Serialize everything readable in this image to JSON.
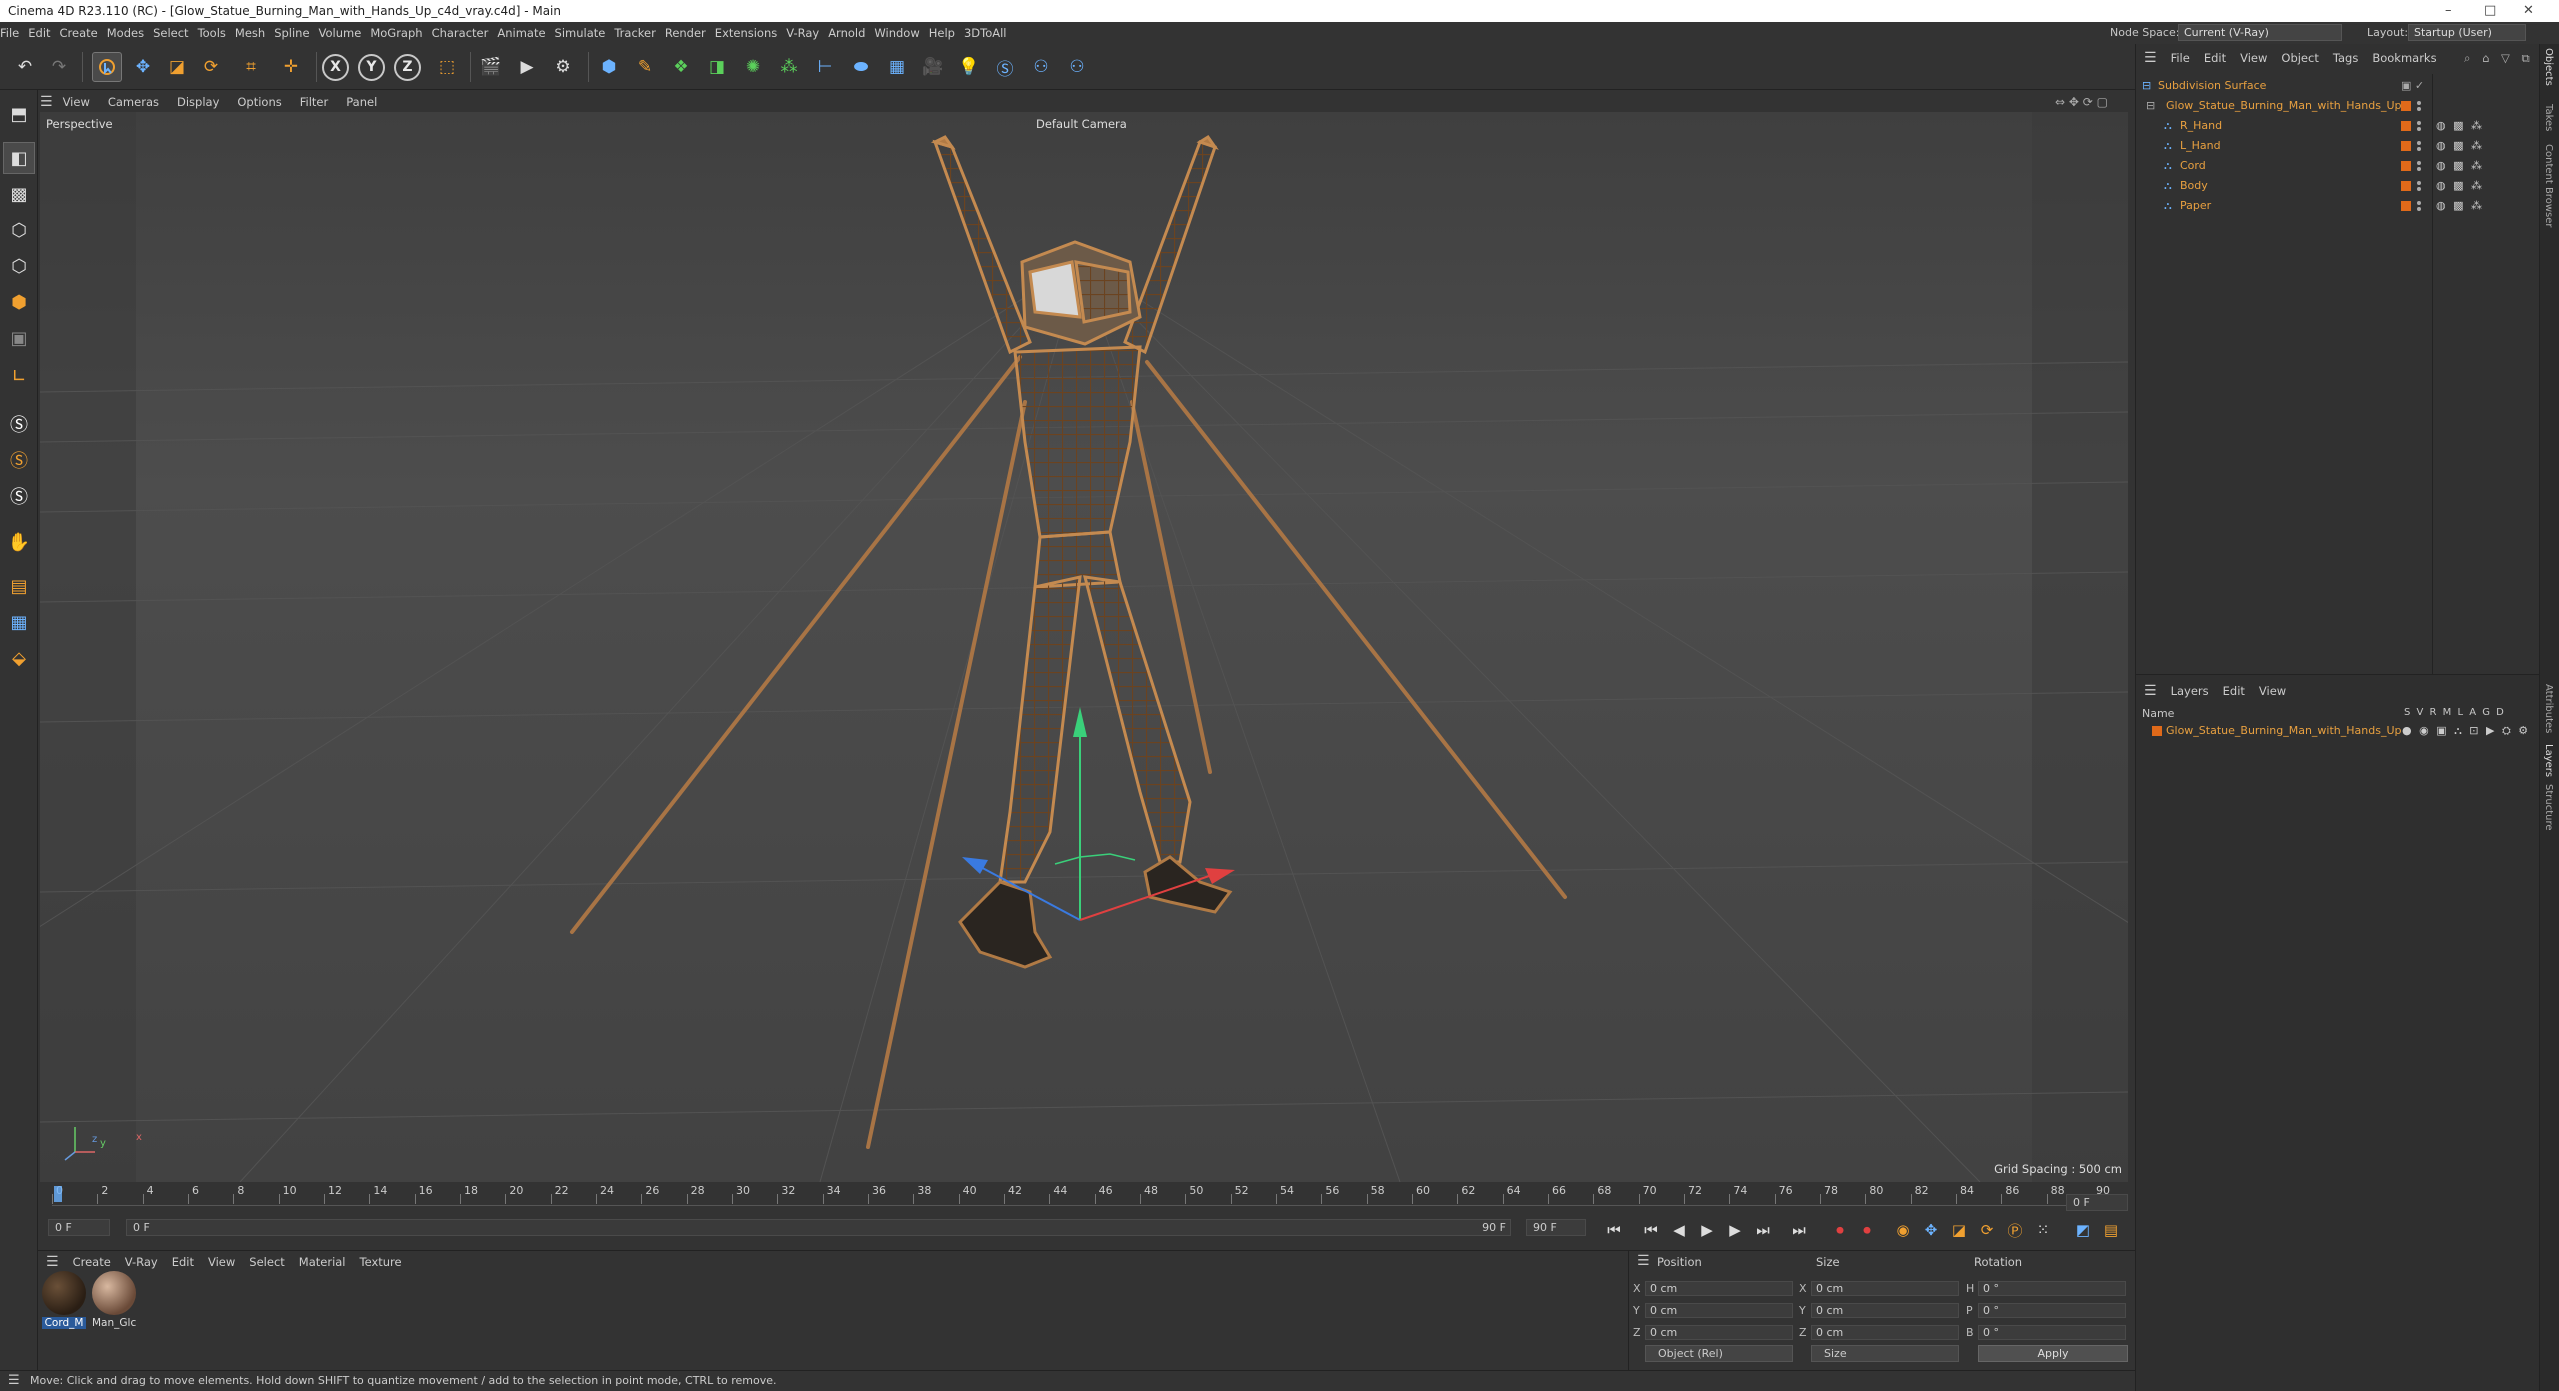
{
  "window": {
    "title": "Cinema 4D R23.110 (RC) - [Glow_Statue_Burning_Man_with_Hands_Up_c4d_vray.c4d] - Main",
    "controls": [
      "–",
      "□",
      "✕"
    ]
  },
  "menubar": {
    "items": [
      "File",
      "Edit",
      "Create",
      "Modes",
      "Select",
      "Tools",
      "Mesh",
      "Spline",
      "Volume",
      "MoGraph",
      "Character",
      "Animate",
      "Simulate",
      "Tracker",
      "Render",
      "Extensions",
      "V-Ray",
      "Arnold",
      "Window",
      "Help",
      "3DToAll"
    ],
    "node_space_label": "Node Space:",
    "node_space_value": "Current (V-Ray)",
    "layout_label": "Layout:",
    "layout_value": "Startup (User)"
  },
  "toolbar": {
    "axis": [
      "X",
      "Y",
      "Z"
    ]
  },
  "viewport": {
    "menu": [
      "View",
      "Cameras",
      "Display",
      "Options",
      "Filter",
      "Panel"
    ],
    "mode": "Perspective",
    "camera": "Default Camera",
    "grid_spacing": "Grid Spacing : 500 cm",
    "axis_x": "x",
    "axis_y": "y",
    "axis_z": "z",
    "icons": "⇔ ✥ ⟳ ▢"
  },
  "timeline": {
    "ticks": [
      "0",
      "2",
      "4",
      "6",
      "8",
      "10",
      "12",
      "14",
      "16",
      "18",
      "20",
      "22",
      "24",
      "26",
      "28",
      "30",
      "32",
      "34",
      "36",
      "38",
      "40",
      "42",
      "44",
      "46",
      "48",
      "50",
      "52",
      "54",
      "56",
      "58",
      "60",
      "62",
      "64",
      "66",
      "68",
      "70",
      "72",
      "74",
      "76",
      "78",
      "80",
      "82",
      "84",
      "86",
      "88",
      "90"
    ],
    "end_frame_box": "0 F",
    "current_frame": "0 F",
    "start_frame": "0 F",
    "range_end": "90 F",
    "range_end2": "90 F"
  },
  "materials": {
    "menu": [
      "Create",
      "V-Ray",
      "Edit",
      "View",
      "Select",
      "Material",
      "Texture"
    ],
    "items": [
      {
        "name": "Cord_M"
      },
      {
        "name": "Man_Glc"
      }
    ]
  },
  "coords": {
    "headers": [
      "Position",
      "Size",
      "Rotation"
    ],
    "rows": [
      {
        "axis": "X",
        "pos": "0 cm",
        "size_axis": "X",
        "size": "0 cm",
        "rot_axis": "H",
        "rot": "0 °"
      },
      {
        "axis": "Y",
        "pos": "0 cm",
        "size_axis": "Y",
        "size": "0 cm",
        "rot_axis": "P",
        "rot": "0 °"
      },
      {
        "axis": "Z",
        "pos": "0 cm",
        "size_axis": "Z",
        "size": "0 cm",
        "rot_axis": "B",
        "rot": "0 °"
      }
    ],
    "mode": "Object (Rel)",
    "size_mode": "Size",
    "apply": "Apply"
  },
  "status": "Move: Click and drag to move elements. Hold down SHIFT to quantize movement / add to the selection in point mode, CTRL to remove.",
  "objects": {
    "menu": [
      "File",
      "Edit",
      "View",
      "Object",
      "Tags",
      "Bookmarks"
    ],
    "tree": [
      {
        "name": "Subdivision Surface",
        "indent": 0
      },
      {
        "name": "Glow_Statue_Burning_Man_with_Hands_Up",
        "indent": 1
      },
      {
        "name": "R_Hand",
        "indent": 2
      },
      {
        "name": "L_Hand",
        "indent": 2
      },
      {
        "name": "Cord",
        "indent": 2
      },
      {
        "name": "Body",
        "indent": 2
      },
      {
        "name": "Paper",
        "indent": 2
      }
    ]
  },
  "layers": {
    "menu": [
      "Layers",
      "Edit",
      "View"
    ],
    "header_name": "Name",
    "header_flags": "S V R M L A G D",
    "items": [
      {
        "name": "Glow_Statue_Burning_Man_with_Hands_Up"
      }
    ]
  },
  "sidetabs": [
    "Objects",
    "Takes",
    "Content Browser",
    "Attributes",
    "Layers",
    "Structure"
  ],
  "colors": {
    "accent_orange": "#e8a040",
    "tag_orange": "#e06a1a",
    "viewport_bg": "#474747",
    "statue": "#b07a45"
  }
}
